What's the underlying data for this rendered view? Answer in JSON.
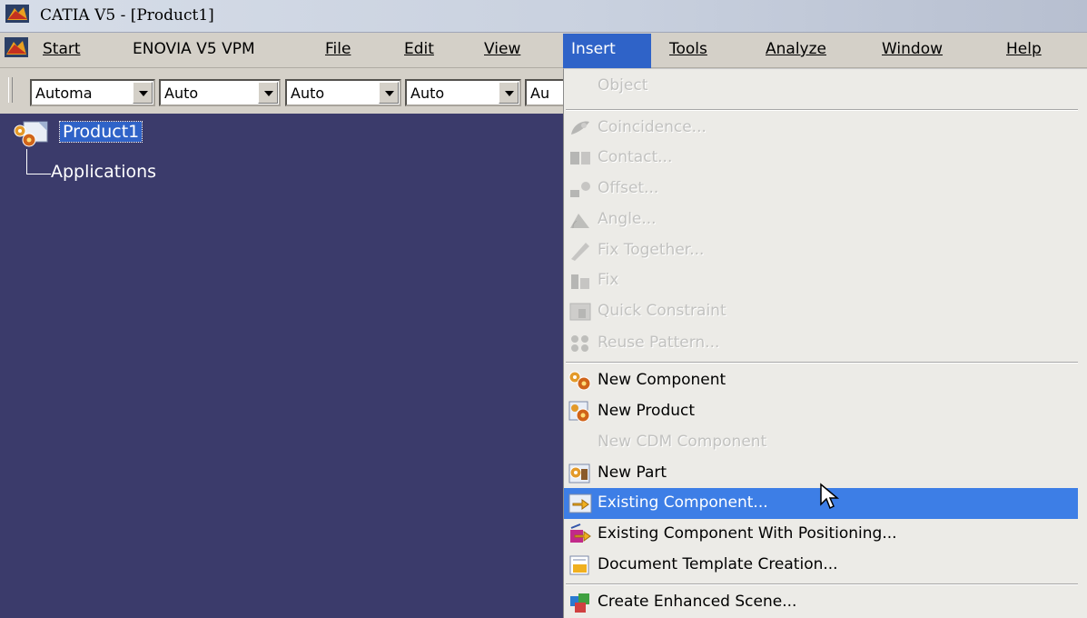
{
  "window": {
    "title": "CATIA V5 - [Product1]"
  },
  "menubar": {
    "items": [
      {
        "label": "Start",
        "accel": "S"
      },
      {
        "label": "ENOVIA V5 VPM",
        "accel": ""
      },
      {
        "label": "File",
        "accel": "F"
      },
      {
        "label": "Edit",
        "accel": "E"
      },
      {
        "label": "View",
        "accel": "V"
      },
      {
        "label": "Insert",
        "accel": "I"
      },
      {
        "label": "Tools",
        "accel": "T"
      },
      {
        "label": "Analyze",
        "accel": "A"
      },
      {
        "label": "Window",
        "accel": "W"
      },
      {
        "label": "Help",
        "accel": "H"
      }
    ]
  },
  "toolbar": {
    "combos": [
      {
        "value": "Automa"
      },
      {
        "value": "Auto"
      },
      {
        "value": "Auto"
      },
      {
        "value": "Auto"
      },
      {
        "value": "Au"
      }
    ]
  },
  "tree": {
    "root": "Product1",
    "children": [
      "Applications"
    ]
  },
  "insert_menu": {
    "items": [
      {
        "label": "Object",
        "enabled": false,
        "icon": "none"
      },
      {
        "label": "Coincidence...",
        "enabled": false,
        "icon": "coincidence-icon"
      },
      {
        "label": "Contact...",
        "enabled": false,
        "icon": "contact-icon"
      },
      {
        "label": "Offset...",
        "enabled": false,
        "icon": "offset-icon"
      },
      {
        "label": "Angle...",
        "enabled": false,
        "icon": "angle-icon"
      },
      {
        "label": "Fix Together...",
        "enabled": false,
        "icon": "fix-together-icon"
      },
      {
        "label": "Fix",
        "enabled": false,
        "icon": "fix-icon"
      },
      {
        "label": "Quick Constraint",
        "enabled": false,
        "icon": "quick-constraint-icon"
      },
      {
        "label": "Reuse Pattern...",
        "enabled": false,
        "icon": "reuse-pattern-icon"
      },
      {
        "label": "New Component",
        "enabled": true,
        "icon": "new-component-icon"
      },
      {
        "label": "New Product",
        "enabled": true,
        "icon": "new-product-icon"
      },
      {
        "label": "New CDM Component",
        "enabled": false,
        "icon": "none"
      },
      {
        "label": "New Part",
        "enabled": true,
        "icon": "new-part-icon"
      },
      {
        "label": "Existing Component...",
        "enabled": true,
        "icon": "existing-component-icon",
        "highlighted": true
      },
      {
        "label": "Existing Component With Positioning...",
        "enabled": true,
        "icon": "existing-component-positioning-icon"
      },
      {
        "label": "Document Template Creation...",
        "enabled": true,
        "icon": "document-template-icon"
      },
      {
        "label": "Create Enhanced Scene...",
        "enabled": true,
        "icon": "enhanced-scene-icon"
      }
    ]
  },
  "colors": {
    "workspace": "#3b3b6b",
    "highlight": "#3d7ee6",
    "menu_bg": "#ecebe7",
    "chrome": "#d4d0c8"
  }
}
